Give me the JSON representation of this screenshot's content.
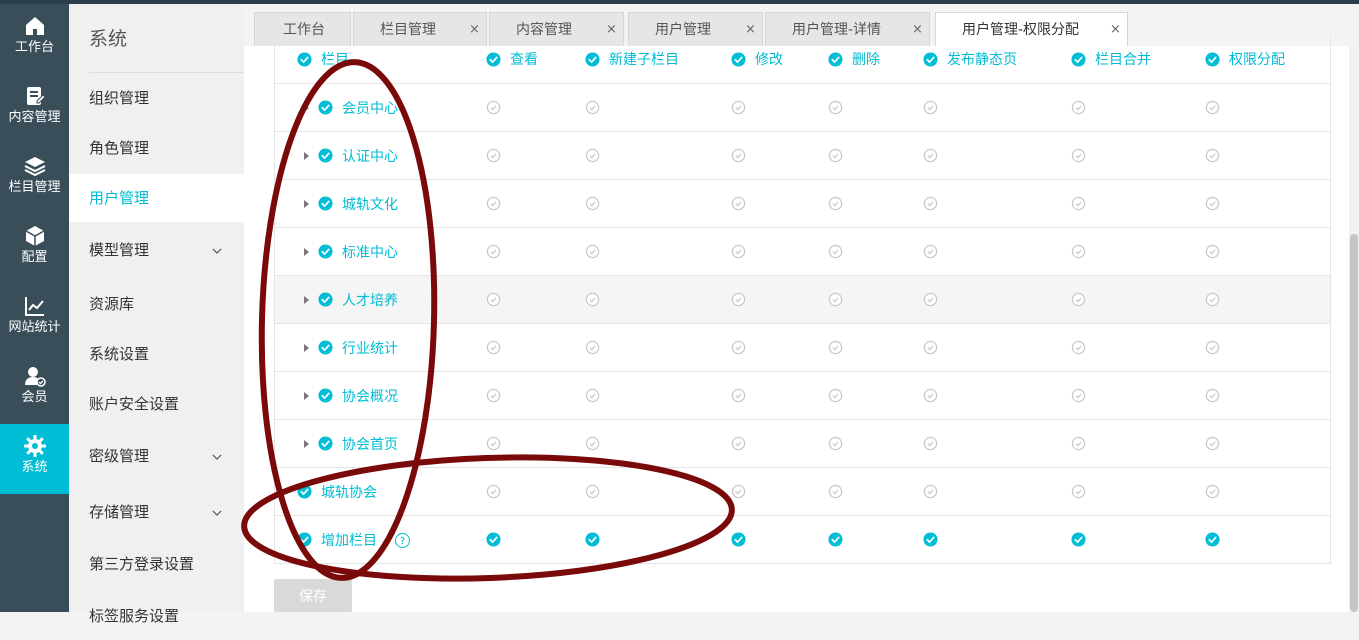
{
  "rail": {
    "items": [
      {
        "label": "工作台",
        "icon": "home-icon",
        "active": false
      },
      {
        "label": "内容管理",
        "icon": "document-edit-icon",
        "active": false
      },
      {
        "label": "栏目管理",
        "icon": "layers-icon",
        "active": false
      },
      {
        "label": "配置",
        "icon": "cube-icon",
        "active": false
      },
      {
        "label": "网站统计",
        "icon": "line-chart-icon",
        "active": false
      },
      {
        "label": "会员",
        "icon": "member-icon",
        "active": false
      },
      {
        "label": "系统",
        "icon": "gear-icon",
        "active": true
      }
    ]
  },
  "menu": {
    "title": "系统",
    "items": [
      {
        "label": "组织管理",
        "expandable": false,
        "active": false
      },
      {
        "label": "角色管理",
        "expandable": false,
        "active": false
      },
      {
        "label": "用户管理",
        "expandable": false,
        "active": true
      },
      {
        "label": "模型管理",
        "expandable": true,
        "active": false
      },
      {
        "label": "资源库",
        "expandable": false,
        "active": false
      },
      {
        "label": "系统设置",
        "expandable": false,
        "active": false
      },
      {
        "label": "账户安全设置",
        "expandable": false,
        "active": false
      },
      {
        "label": "密级管理",
        "expandable": true,
        "active": false
      },
      {
        "label": "存储管理",
        "expandable": true,
        "active": false
      },
      {
        "label": "第三方登录设置",
        "expandable": false,
        "active": false
      },
      {
        "label": "标签服务设置",
        "expandable": false,
        "active": false
      }
    ]
  },
  "tabs": [
    {
      "label": "工作台",
      "closable": false,
      "active": false
    },
    {
      "label": "栏目管理",
      "closable": true,
      "active": false
    },
    {
      "label": "内容管理",
      "closable": true,
      "active": false
    },
    {
      "label": "用户管理",
      "closable": true,
      "active": false
    },
    {
      "label": "用户管理-详情",
      "closable": true,
      "active": false
    },
    {
      "label": "用户管理-权限分配",
      "closable": true,
      "active": true
    }
  ],
  "tab_close_glyph": "×",
  "permissions": {
    "columns": [
      "栏目",
      "查看",
      "新建子栏目",
      "修改",
      "删除",
      "发布静态页",
      "栏目合并",
      "权限分配"
    ],
    "rows": [
      {
        "label": "会员中心",
        "expandable": true,
        "checked": false
      },
      {
        "label": "认证中心",
        "expandable": true,
        "checked": false
      },
      {
        "label": "城轨文化",
        "expandable": true,
        "checked": false
      },
      {
        "label": "标准中心",
        "expandable": true,
        "checked": false
      },
      {
        "label": "人才培养",
        "expandable": true,
        "checked": false,
        "hover": true
      },
      {
        "label": "行业统计",
        "expandable": true,
        "checked": false
      },
      {
        "label": "协会概况",
        "expandable": true,
        "checked": false
      },
      {
        "label": "协会首页",
        "expandable": true,
        "checked": false
      },
      {
        "label": "城轨协会",
        "expandable": false,
        "checked": false
      },
      {
        "label": "增加栏目",
        "expandable": false,
        "checked": true,
        "help": "?"
      }
    ]
  },
  "save_label": "保存",
  "colors": {
    "accent": "#00bcd4",
    "rail_bg": "#3a4e5a",
    "annotation": "#7a0a0a",
    "check_off": "#c8c8c8"
  }
}
